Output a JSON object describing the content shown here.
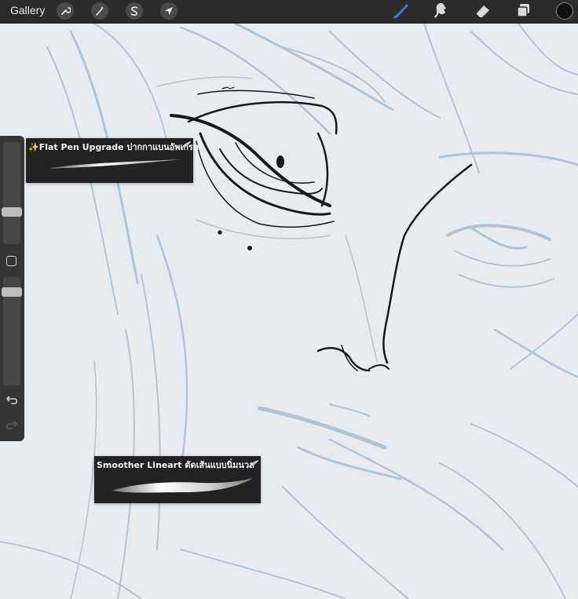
{
  "toolbar": {
    "gallery_label": "Gallery",
    "left_tools": [
      {
        "icon": "wrench-icon",
        "name": "actions-button"
      },
      {
        "icon": "magic-wand-icon",
        "name": "adjustments-button"
      },
      {
        "icon": "selection-s-icon",
        "name": "selection-button"
      },
      {
        "icon": "arrow-cursor-icon",
        "name": "transform-button"
      }
    ],
    "right_tools": [
      {
        "icon": "brush-icon",
        "name": "brush-tool-button",
        "active": true
      },
      {
        "icon": "smudge-icon",
        "name": "smudge-tool-button",
        "active": false
      },
      {
        "icon": "eraser-icon",
        "name": "eraser-tool-button",
        "active": false
      },
      {
        "icon": "layers-icon",
        "name": "layers-button",
        "active": false
      }
    ],
    "current_color": "#111111",
    "accent_color": "#2f7fe0"
  },
  "sidebar": {
    "brush_size_level": 0.3,
    "opacity_level": 0.9,
    "modify_icon": "square-icon",
    "undo_icon": "undo-icon",
    "redo_icon": "redo-icon"
  },
  "brushes": [
    {
      "name": "✨Flat Pen Upgrade ปากกาแบนอัพเกรด"
    },
    {
      "name": "Smoother Lineart ตัดเส้นแบบนิ่มนวล"
    }
  ],
  "canvas": {
    "background": "#e9ecef",
    "sketch_color": "#9fb3c9",
    "ink_color": "#15181d"
  }
}
